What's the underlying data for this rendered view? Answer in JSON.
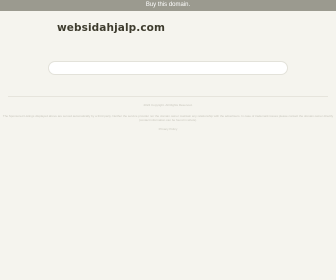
{
  "topbar": {
    "label": "Buy this domain."
  },
  "site": {
    "title": "websidahjalp.com"
  },
  "search": {
    "value": "",
    "placeholder": ""
  },
  "footer": {
    "line1": "2024 Copyright. All Rights Reserved.",
    "line2": "The Sponsored Listings displayed above are served automatically by a third party. Neither the service provider nor the domain owner maintain any relationship with the advertisers. In case of trademark issues please contact the domain owner directly (contact information can be found in whois).",
    "line3": "",
    "line4": "Privacy Policy"
  }
}
